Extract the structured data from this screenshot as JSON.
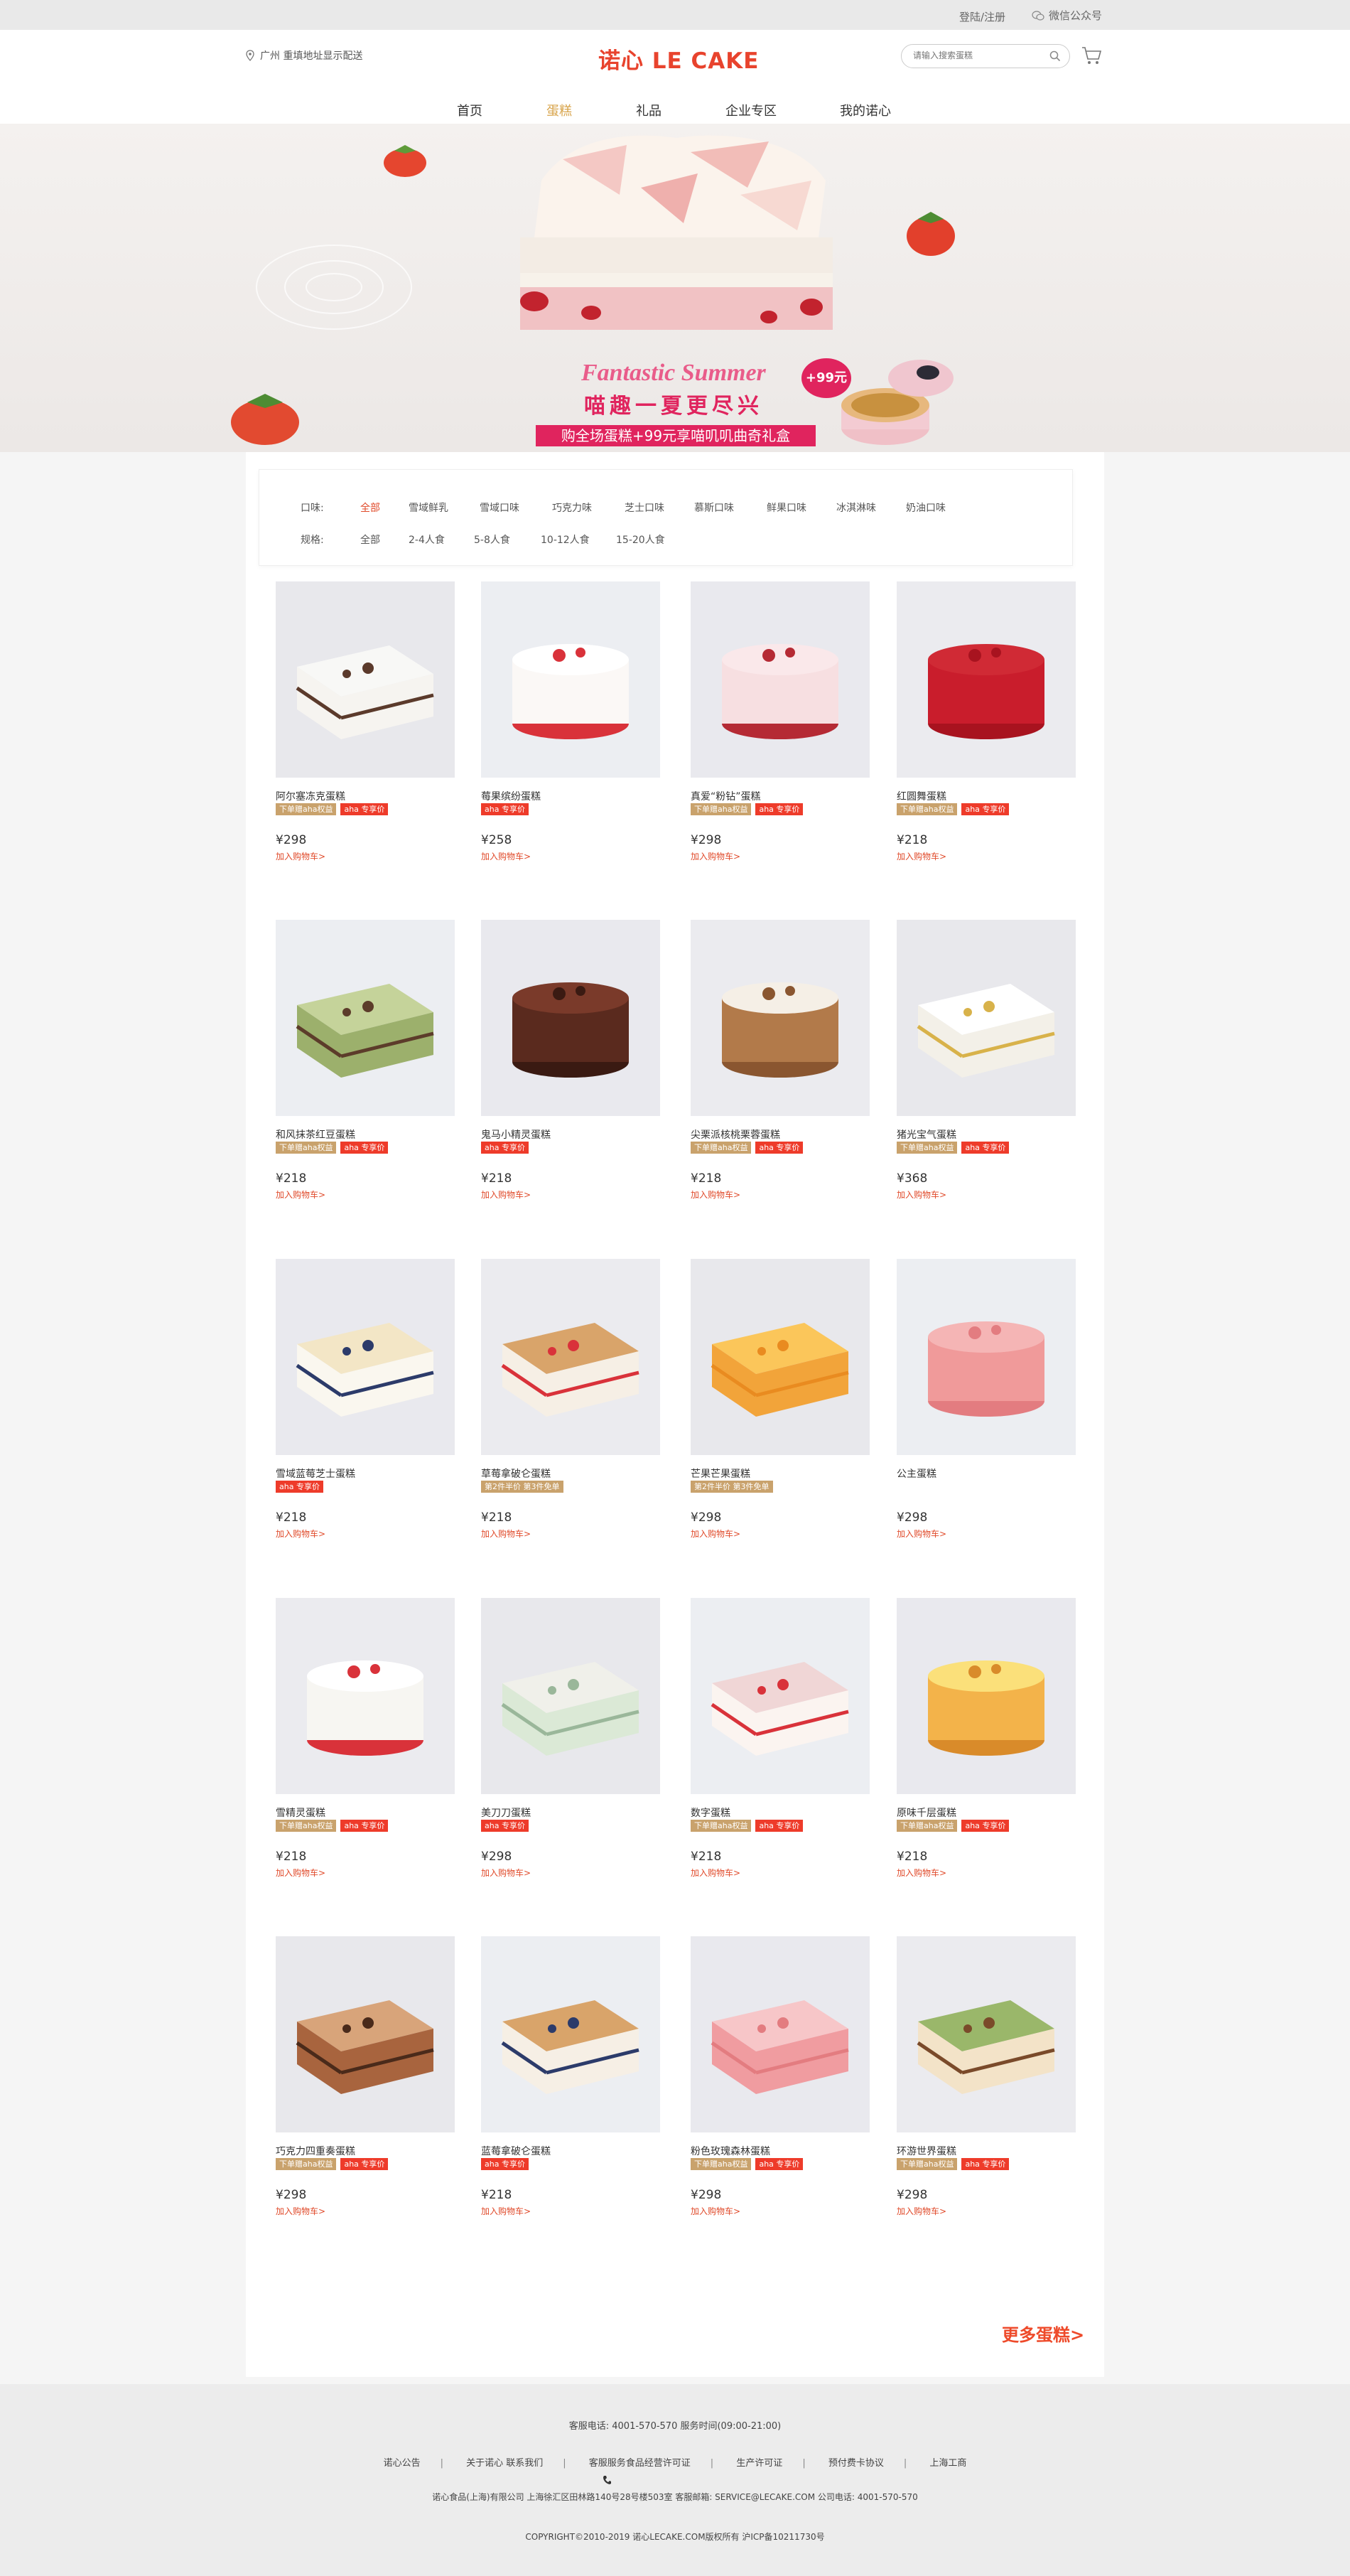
{
  "topbar": {
    "login": "登陆/注册",
    "wechat": "微信公众号"
  },
  "header": {
    "location": "广州 重填地址显示配送",
    "logo": "诺心 LE CAKE",
    "search_placeholder": "请输入搜索蛋糕",
    "nav": [
      "首页",
      "蛋糕",
      "礼品",
      "企业专区",
      "我的诺心"
    ],
    "nav_active": "蛋糕"
  },
  "banner": {
    "title_en": "Fantastic Summer",
    "title_cn": "喵趣一夏更尽兴",
    "subtitle": "购全场蛋糕+99元享喵叽叽曲奇礼盒",
    "badge": "+99元"
  },
  "filter": {
    "flavor_label": "口味:",
    "flavors": [
      "全部",
      "雪域鲜乳",
      "雪域口味",
      "巧克力味",
      "芝士口味",
      "慕斯口味",
      "鲜果口味",
      "冰淇淋味",
      "奶油口味"
    ],
    "size_label": "规格:",
    "sizes": [
      "全部",
      "2-4人食",
      "5-8人食",
      "10-12人食",
      "15-20人食"
    ]
  },
  "products": [
    {
      "name": "阿尔塞冻克蛋糕",
      "tags": [
        "下单赠aha权益",
        "aha 专享价"
      ],
      "price": "¥298",
      "add": "加入购物车>"
    },
    {
      "name": "莓果缤纷蛋糕",
      "tags": [
        "aha 专享价"
      ],
      "price": "¥258",
      "add": "加入购物车>"
    },
    {
      "name": "真爱“粉钻”蛋糕",
      "tags": [
        "下单赠aha权益",
        "aha 专享价"
      ],
      "price": "¥298",
      "add": "加入购物车>"
    },
    {
      "name": "红圆舞蛋糕",
      "tags": [
        "下单赠aha权益",
        "aha 专享价"
      ],
      "price": "¥218",
      "add": "加入购物车>"
    },
    {
      "name": "和风抹茶红豆蛋糕",
      "tags": [
        "下单赠aha权益",
        "aha 专享价"
      ],
      "price": "¥218",
      "add": "加入购物车>"
    },
    {
      "name": "鬼马小精灵蛋糕",
      "tags": [
        "aha 专享价"
      ],
      "price": "¥218",
      "add": "加入购物车>"
    },
    {
      "name": "尖栗派核桃栗蓉蛋糕",
      "tags": [
        "下单赠aha权益",
        "aha 专享价"
      ],
      "price": "¥218",
      "add": "加入购物车>"
    },
    {
      "name": "猪光宝气蛋糕",
      "tags": [
        "下单赠aha权益",
        "aha 专享价"
      ],
      "price": "¥368",
      "add": "加入购物车>"
    },
    {
      "name": "雪域蓝莓芝士蛋糕",
      "tags": [
        "aha 专享价"
      ],
      "price": "¥218",
      "add": "加入购物车>"
    },
    {
      "name": "草莓拿破仑蛋糕",
      "tags": [
        "第2件半价 第3件免单"
      ],
      "price": "¥218",
      "add": "加入购物车>"
    },
    {
      "name": "芒果芒果蛋糕",
      "tags": [
        "第2件半价 第3件免单"
      ],
      "price": "¥298",
      "add": "加入购物车>"
    },
    {
      "name": "公主蛋糕",
      "tags": [],
      "price": "¥298",
      "add": "加入购物车>"
    },
    {
      "name": "雪精灵蛋糕",
      "tags": [
        "下单赠aha权益",
        "aha 专享价"
      ],
      "price": "¥218",
      "add": "加入购物车>"
    },
    {
      "name": "美刀刀蛋糕",
      "tags": [
        "aha 专享价"
      ],
      "price": "¥298",
      "add": "加入购物车>"
    },
    {
      "name": "数字蛋糕",
      "tags": [
        "下单赠aha权益",
        "aha 专享价"
      ],
      "price": "¥218",
      "add": "加入购物车>"
    },
    {
      "name": "原味千层蛋糕",
      "tags": [
        "下单赠aha权益",
        "aha 专享价"
      ],
      "price": "¥218",
      "add": "加入购物车>"
    },
    {
      "name": "巧克力四重奏蛋糕",
      "tags": [
        "下单赠aha权益",
        "aha 专享价"
      ],
      "price": "¥298",
      "add": "加入购物车>"
    },
    {
      "name": "蓝莓拿破仑蛋糕",
      "tags": [
        "aha 专享价"
      ],
      "price": "¥218",
      "add": "加入购物车>"
    },
    {
      "name": "粉色玫瑰森林蛋糕",
      "tags": [
        "下单赠aha权益",
        "aha 专享价"
      ],
      "price": "¥298",
      "add": "加入购物车>"
    },
    {
      "name": "环游世界蛋糕",
      "tags": [
        "下单赠aha权益",
        "aha 专享价"
      ],
      "price": "¥298",
      "add": "加入购物车>"
    }
  ],
  "more": "更多蛋糕>",
  "footer": {
    "service": "客服电话: 4001-570-570 服务时间(09:00-21:00)",
    "links": [
      "诺心公告",
      "关于诺心 联系我们",
      "客服服务食品经营许可证",
      "生产许可证",
      "预付费卡协议",
      "上海工商"
    ],
    "company": "诺心食品(上海)有限公司   上海徐汇区田林路140号28号楼503室   客服邮箱: SERVICE@LECAKE.COM   公司电话: 4001-570-570",
    "copyright": "COPYRIGHT©2010-2019 诺心LECAKE.COM版权所有 沪ICP备10211730号"
  },
  "colors": {
    "brand": "#e8432d",
    "active_nav": "#d8a44b",
    "tag_gold": "#c9a26c",
    "tag_red": "#ee3b2a",
    "banner_pink": "#e0245e"
  }
}
